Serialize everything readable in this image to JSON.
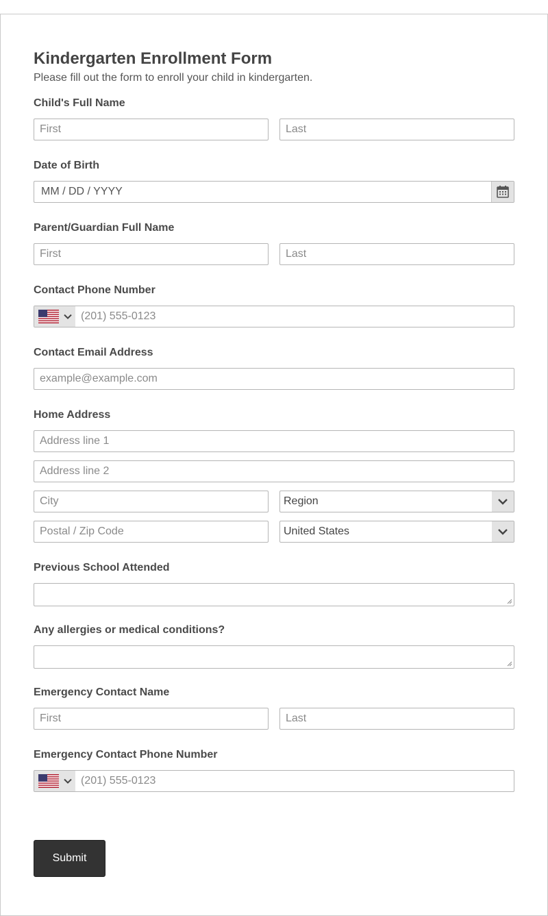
{
  "form": {
    "title": "Kindergarten Enrollment Form",
    "subtitle": "Please fill out the form to enroll your child in kindergarten."
  },
  "child_name": {
    "label": "Child's Full Name",
    "first_placeholder": "First",
    "last_placeholder": "Last"
  },
  "dob": {
    "label": "Date of Birth",
    "placeholder": "MM / DD / YYYY",
    "icon": "calendar-icon"
  },
  "parent_name": {
    "label": "Parent/Guardian Full Name",
    "first_placeholder": "First",
    "last_placeholder": "Last"
  },
  "phone": {
    "label": "Contact Phone Number",
    "placeholder": "(201) 555-0123",
    "country_icon": "us-flag-icon"
  },
  "email": {
    "label": "Contact Email Address",
    "placeholder": "example@example.com"
  },
  "address": {
    "label": "Home Address",
    "line1_placeholder": "Address line 1",
    "line2_placeholder": "Address line 2",
    "city_placeholder": "City",
    "region_value": "Region",
    "postal_placeholder": "Postal / Zip Code",
    "country_value": "United States"
  },
  "previous_school": {
    "label": "Previous School Attended"
  },
  "allergies": {
    "label": "Any allergies or medical conditions?"
  },
  "emergency_name": {
    "label": "Emergency Contact Name",
    "first_placeholder": "First",
    "last_placeholder": "Last"
  },
  "emergency_phone": {
    "label": "Emergency Contact Phone Number",
    "placeholder": "(201) 555-0123",
    "country_icon": "us-flag-icon"
  },
  "submit_label": "Submit",
  "colors": {
    "button_bg": "#333333",
    "button_text": "#ffffff",
    "border": "#b5b5b5",
    "addon_bg": "#e3e3e3"
  }
}
